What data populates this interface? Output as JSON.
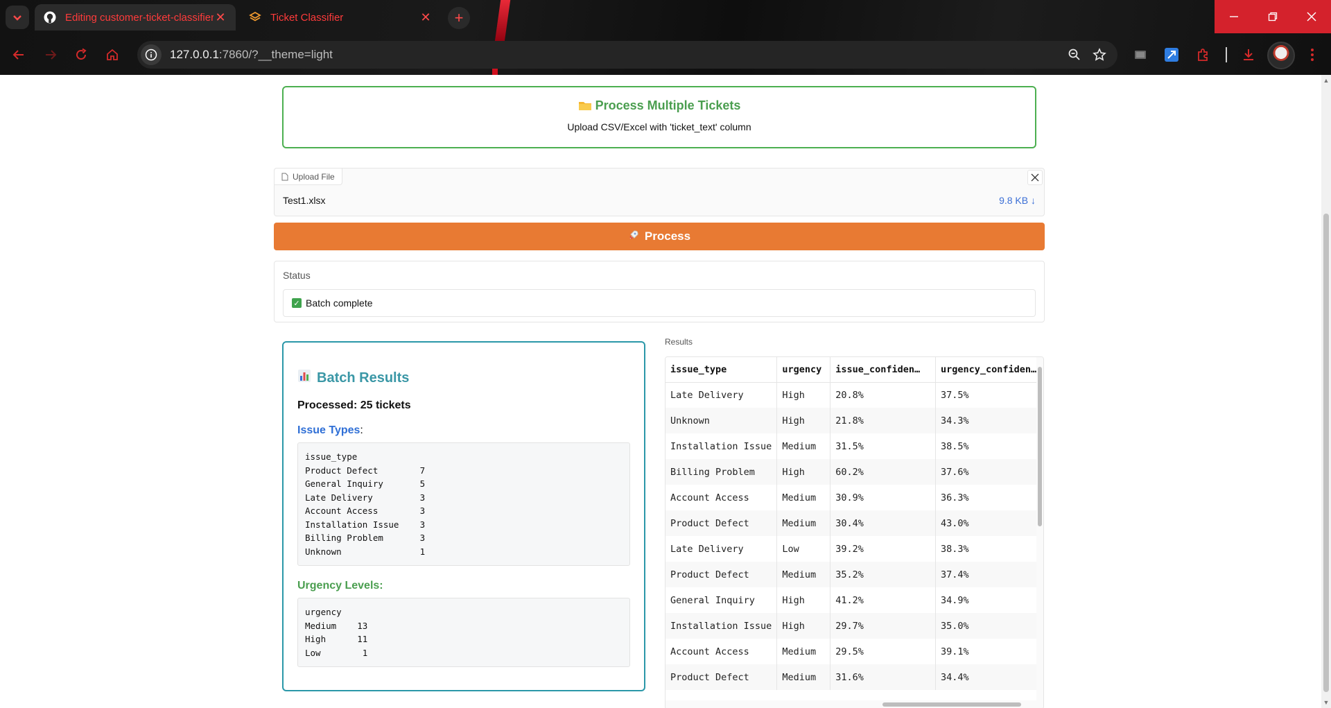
{
  "browser": {
    "tabs": [
      {
        "label": "Editing customer-ticket-classifier",
        "icon": "github-icon"
      },
      {
        "label": "Ticket Classifier",
        "icon": "gradio-icon"
      }
    ],
    "url_host": "127.0.0.1",
    "url_rest": ":7860/?__theme=light",
    "accent": "#d4222c"
  },
  "header": {
    "title": "Process Multiple Tickets",
    "subtitle": "Upload CSV/Excel with 'ticket_text' column"
  },
  "upload": {
    "label": "Upload File",
    "file_name": "Test1.xlsx",
    "file_size": "9.8 KB ↓"
  },
  "process_button": {
    "label": "Process"
  },
  "status": {
    "label": "Status",
    "value": "Batch complete"
  },
  "batch": {
    "title": "Batch Results",
    "processed": "Processed: 25 tickets",
    "issue_heading": "Issue Types",
    "issue_colon": ":",
    "issue_text": "issue_type\nProduct Defect        7\nGeneral Inquiry       5\nLate Delivery         3\nAccount Access        3\nInstallation Issue    3\nBilling Problem       3\nUnknown               1",
    "urgency_heading": "Urgency Levels:",
    "urgency_text": "urgency\nMedium    13\nHigh      11\nLow        1"
  },
  "results": {
    "label": "Results",
    "columns": [
      "issue_type",
      "urgency",
      "issue_confiden…",
      "urgency_confiden…"
    ],
    "rows": [
      [
        "Late Delivery",
        "High",
        "20.8%",
        "37.5%"
      ],
      [
        "Unknown",
        "High",
        "21.8%",
        "34.3%"
      ],
      [
        "Installation Issue",
        "Medium",
        "31.5%",
        "38.5%"
      ],
      [
        "Billing Problem",
        "High",
        "60.2%",
        "37.6%"
      ],
      [
        "Account Access",
        "Medium",
        "30.9%",
        "36.3%"
      ],
      [
        "Product Defect",
        "Medium",
        "30.4%",
        "43.0%"
      ],
      [
        "Late Delivery",
        "Low",
        "39.2%",
        "38.3%"
      ],
      [
        "Product Defect",
        "Medium",
        "35.2%",
        "37.4%"
      ],
      [
        "General Inquiry",
        "High",
        "41.2%",
        "34.9%"
      ],
      [
        "Installation Issue",
        "High",
        "29.7%",
        "35.0%"
      ],
      [
        "Account Access",
        "Medium",
        "29.5%",
        "39.1%"
      ],
      [
        "Product Defect",
        "Medium",
        "31.6%",
        "34.4%"
      ]
    ]
  }
}
